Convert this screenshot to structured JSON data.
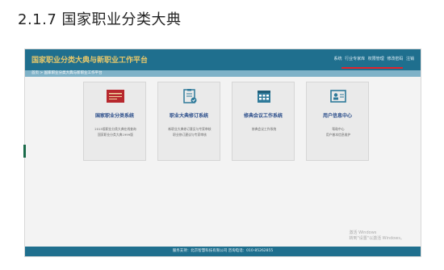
{
  "doc": {
    "heading": "2.1.7 国家职业分类大典"
  },
  "header": {
    "app_title": "国家职业分类大典与新职业工作平台",
    "links": [
      "系统",
      "行业专家库",
      "权限管理",
      "修改密码",
      "注销"
    ]
  },
  "breadcrumb": "首页 > 国家职业分类大典与新职业工作平台",
  "cards": [
    {
      "name": "国家职业分类系统",
      "line1": "2015版职业分类大典在线查询",
      "line2": "国家职业分类大典1999版",
      "icon": "book-icon"
    },
    {
      "name": "职业大典修订系统",
      "line1": "新职业大典修订意见与专家审核",
      "line2": "职业修订建议与专家审核",
      "icon": "clipboard-check-icon"
    },
    {
      "name": "修典会议工作系统",
      "line1": "修典会议工作系统",
      "line2": "",
      "icon": "calendar-icon"
    },
    {
      "name": "用户信息中心",
      "line1": "帮助中心",
      "line2": "用户基本信息维护",
      "icon": "id-card-icon"
    }
  ],
  "watermark": {
    "line1": "激活 Windows",
    "line2": "转到\"设置\"以激活 Windows。"
  },
  "footer": "服务支持：北京智慧科技有限公司    咨询电话：010-85262855",
  "colors": {
    "header_bg": "#1f6f8e",
    "title_gold": "#e8c86a",
    "card_title": "#2a4d8a",
    "underline_red": "#e0242c"
  }
}
